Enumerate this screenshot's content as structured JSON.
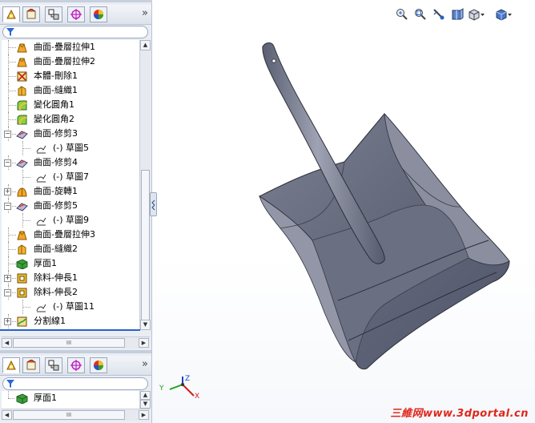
{
  "feature_tree": {
    "tabs": [
      {
        "name": "feature-manager",
        "icon": "feature-tree-icon"
      },
      {
        "name": "property-manager",
        "icon": "property-icon"
      },
      {
        "name": "configuration-manager",
        "icon": "configuration-icon"
      },
      {
        "name": "dimxpert-manager",
        "icon": "target-icon"
      },
      {
        "name": "display-manager",
        "icon": "appearance-icon"
      }
    ],
    "more_label": "»",
    "items": [
      {
        "label": "曲面-疊層拉伸1",
        "icon": "loft-surface-icon",
        "indent": 0,
        "expandable": false
      },
      {
        "label": "曲面-疊層拉伸2",
        "icon": "loft-surface-icon",
        "indent": 0,
        "expandable": false
      },
      {
        "label": "本體-刪除1",
        "icon": "delete-body-icon",
        "indent": 0,
        "expandable": false
      },
      {
        "label": "曲面-縫織1",
        "icon": "knit-surface-icon",
        "indent": 0,
        "expandable": false
      },
      {
        "label": "變化圓角1",
        "icon": "variable-fillet-icon",
        "indent": 0,
        "expandable": false
      },
      {
        "label": "變化圓角2",
        "icon": "variable-fillet-icon",
        "indent": 0,
        "expandable": false
      },
      {
        "label": "曲面-修剪3",
        "icon": "trim-surface-icon",
        "indent": 0,
        "expandable": true,
        "expanded": true
      },
      {
        "label": "(-) 草圖5",
        "icon": "sketch-icon",
        "indent": 1,
        "expandable": false
      },
      {
        "label": "曲面-修剪4",
        "icon": "trim-surface-icon",
        "indent": 0,
        "expandable": true,
        "expanded": true
      },
      {
        "label": "(-) 草圖7",
        "icon": "sketch-icon",
        "indent": 1,
        "expandable": false
      },
      {
        "label": "曲面-旋轉1",
        "icon": "revolve-surface-icon",
        "indent": 0,
        "expandable": true,
        "expanded": false
      },
      {
        "label": "曲面-修剪5",
        "icon": "trim-surface-icon",
        "indent": 0,
        "expandable": true,
        "expanded": true
      },
      {
        "label": "(-) 草圖9",
        "icon": "sketch-icon",
        "indent": 1,
        "expandable": false
      },
      {
        "label": "曲面-疊層拉伸3",
        "icon": "loft-surface-icon",
        "indent": 0,
        "expandable": false
      },
      {
        "label": "曲面-縫織2",
        "icon": "knit-surface-icon",
        "indent": 0,
        "expandable": false
      },
      {
        "label": "厚面1",
        "icon": "thicken-icon",
        "indent": 0,
        "expandable": false
      },
      {
        "label": "除料-伸長1",
        "icon": "cut-extrude-icon",
        "indent": 0,
        "expandable": true,
        "expanded": false
      },
      {
        "label": "除料-伸長2",
        "icon": "cut-extrude-icon",
        "indent": 0,
        "expandable": true,
        "expanded": true
      },
      {
        "label": "(-) 草圖11",
        "icon": "sketch-icon",
        "indent": 1,
        "expandable": false
      },
      {
        "label": "分割線1",
        "icon": "split-line-icon",
        "indent": 0,
        "expandable": true,
        "expanded": false
      }
    ],
    "hscroll_thumb": "III"
  },
  "property_panel": {
    "items": [
      {
        "label": "厚面1",
        "icon": "thicken-icon"
      }
    ],
    "hscroll_thumb": "III"
  },
  "view_toolbar": [
    "zoom-to-fit-icon",
    "zoom-area-icon",
    "previous-view-icon",
    "section-view-icon",
    "view-orientation-icon",
    "display-style-icon"
  ],
  "triad": {
    "x_label": "X",
    "y_label": "Y",
    "z_label": "Z"
  },
  "watermark": "三維网www.3dportal.cn",
  "colors": {
    "panel_bg": "#e9edf4",
    "model_gray": "#6e7280",
    "watermark": "#e0261b"
  }
}
